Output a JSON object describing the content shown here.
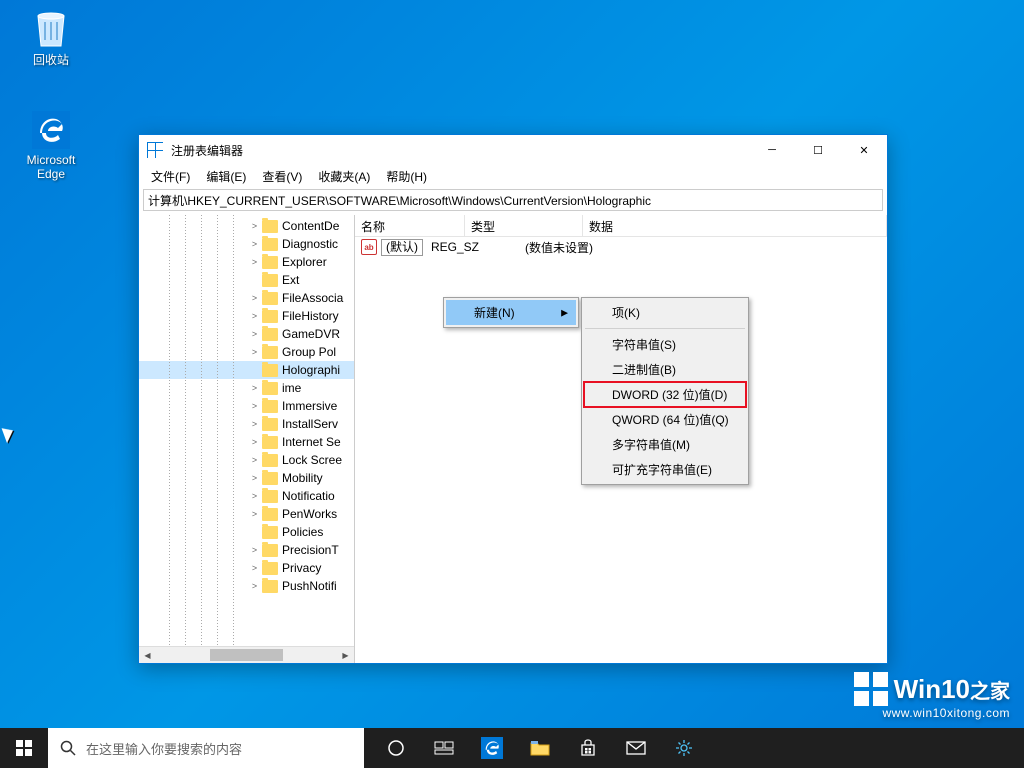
{
  "desktop": {
    "recycle": "回收站",
    "edge": "Microsoft\nEdge"
  },
  "window": {
    "title": "注册表编辑器",
    "menu": [
      "文件(F)",
      "编辑(E)",
      "查看(V)",
      "收藏夹(A)",
      "帮助(H)"
    ],
    "address": "计算机\\HKEY_CURRENT_USER\\SOFTWARE\\Microsoft\\Windows\\CurrentVersion\\Holographic",
    "tree": [
      {
        "label": "ContentDe",
        "exp": ">"
      },
      {
        "label": "Diagnostic",
        "exp": ">"
      },
      {
        "label": "Explorer",
        "exp": ">"
      },
      {
        "label": "Ext",
        "exp": ""
      },
      {
        "label": "FileAssocia",
        "exp": ">"
      },
      {
        "label": "FileHistory",
        "exp": ">"
      },
      {
        "label": "GameDVR",
        "exp": ">"
      },
      {
        "label": "Group Pol",
        "exp": ">"
      },
      {
        "label": "Holographi",
        "exp": "",
        "selected": true
      },
      {
        "label": "ime",
        "exp": ">"
      },
      {
        "label": "Immersive",
        "exp": ">"
      },
      {
        "label": "InstallServ",
        "exp": ">"
      },
      {
        "label": "Internet Se",
        "exp": ">"
      },
      {
        "label": "Lock Scree",
        "exp": ">"
      },
      {
        "label": "Mobility",
        "exp": ">"
      },
      {
        "label": "Notificatio",
        "exp": ">"
      },
      {
        "label": "PenWorks",
        "exp": ">"
      },
      {
        "label": "Policies",
        "exp": ""
      },
      {
        "label": "PrecisionT",
        "exp": ">"
      },
      {
        "label": "Privacy",
        "exp": ">"
      },
      {
        "label": "PushNotifi",
        "exp": ">"
      }
    ],
    "cols": {
      "name": "名称",
      "type": "类型",
      "data": "数据"
    },
    "row": {
      "name": "(默认)",
      "type": "REG_SZ",
      "data": "(数值未设置)"
    }
  },
  "ctx1": {
    "new": "新建(N)"
  },
  "ctx2": {
    "key": "项(K)",
    "string": "字符串值(S)",
    "binary": "二进制值(B)",
    "dword": "DWORD (32 位)值(D)",
    "qword": "QWORD (64 位)值(Q)",
    "multi": "多字符串值(M)",
    "expand": "可扩充字符串值(E)"
  },
  "taskbar": {
    "search_placeholder": "在这里输入你要搜索的内容"
  },
  "watermark": {
    "brand": "Win10",
    "suffix": "之家",
    "url": "www.win10xitong.com"
  }
}
